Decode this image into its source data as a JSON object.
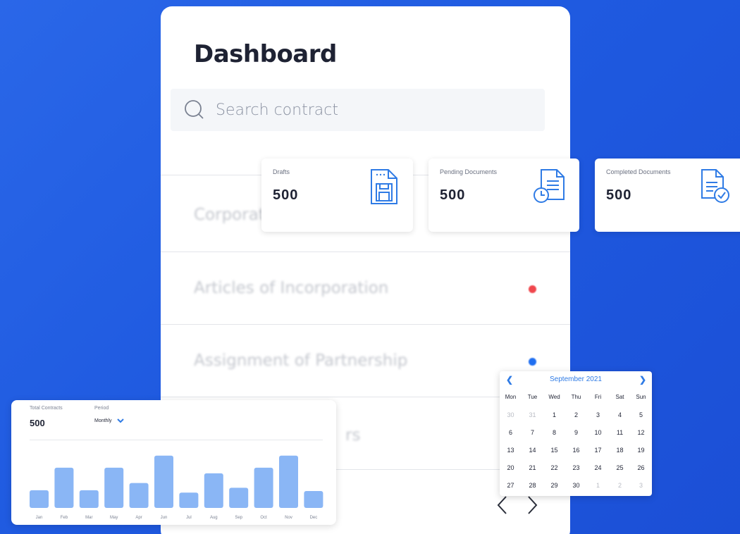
{
  "dashboard": {
    "title": "Dashboard",
    "search_placeholder": "Search contract",
    "rows": [
      {
        "label": "Corporate",
        "dot_color": null
      },
      {
        "label": "Articles of Incorporation",
        "dot_color": "#f0474d"
      },
      {
        "label": "Assignment of Partnership",
        "dot_color": "#1f6ef0"
      },
      {
        "label": "rs",
        "dot_color": null
      }
    ]
  },
  "stats": [
    {
      "label": "Drafts",
      "value": "500",
      "icon": "floppy-document-icon"
    },
    {
      "label": "Pending Documents",
      "value": "500",
      "icon": "clock-document-icon"
    },
    {
      "label": "Completed Documents",
      "value": "500",
      "icon": "check-document-icon"
    }
  ],
  "contracts_card": {
    "total_label": "Total Contracts",
    "total_value": "500",
    "period_label": "Period",
    "period_value": "Monthly"
  },
  "chart_data": {
    "type": "bar",
    "categories": [
      "Jan",
      "Feb",
      "Mar",
      "May",
      "Apr",
      "Jun",
      "Jul",
      "Aug",
      "Sep",
      "Oct",
      "Nov",
      "Dec"
    ],
    "values": [
      22,
      50,
      22,
      50,
      31,
      65,
      19,
      43,
      25,
      50,
      65,
      21
    ],
    "ylim": [
      0,
      70
    ],
    "color": "#8ab6f5"
  },
  "calendar": {
    "month_label": "September 2021",
    "weekdays": [
      "Mon",
      "Tue",
      "Wed",
      "Thu",
      "Fri",
      "Sat",
      "Sun"
    ],
    "weeks": [
      [
        "30",
        "31",
        "1",
        "2",
        "3",
        "4",
        "5"
      ],
      [
        "6",
        "7",
        "8",
        "9",
        "10",
        "11",
        "12"
      ],
      [
        "13",
        "14",
        "15",
        "16",
        "17",
        "18",
        "19"
      ],
      [
        "20",
        "21",
        "22",
        "23",
        "24",
        "25",
        "26"
      ],
      [
        "27",
        "28",
        "29",
        "30",
        "1",
        "2",
        "3"
      ]
    ],
    "outside_month": [
      [
        0,
        0
      ],
      [
        0,
        1
      ],
      [
        4,
        4
      ],
      [
        4,
        5
      ],
      [
        4,
        6
      ]
    ],
    "accent": "#2f7be5"
  }
}
